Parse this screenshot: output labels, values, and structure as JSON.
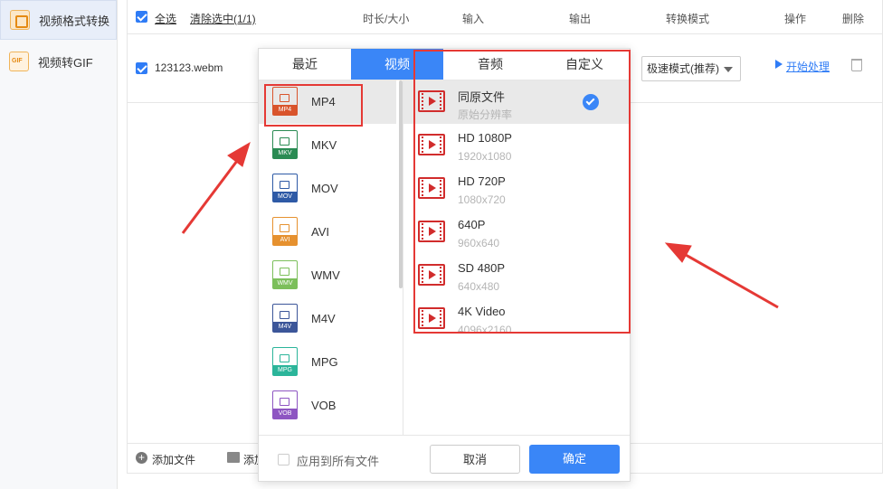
{
  "sidebar": {
    "items": [
      {
        "label": "视频格式转换",
        "active": true,
        "icon": "convert-icon"
      },
      {
        "label": "视频转GIF",
        "active": false,
        "icon": "gif-icon"
      }
    ]
  },
  "header": {
    "select_all": "全选",
    "clear_selected": "清除选中(1/1)",
    "col_duration": "时长/大小",
    "col_input": "输入",
    "col_output": "输出",
    "col_mode": "转换模式",
    "col_action": "操作",
    "col_delete": "删除"
  },
  "file": {
    "name": "123123.webm",
    "mode": "极速模式(推荐)",
    "start": "开始处理"
  },
  "bottom": {
    "add_file": "添加文件",
    "add_folder": "添加"
  },
  "dialog": {
    "tabs": [
      "最近",
      "视频",
      "音频",
      "自定义"
    ],
    "active_tab": "视频",
    "formats": [
      {
        "name": "MP4",
        "label": "MP4",
        "color": "#d9542c"
      },
      {
        "name": "MKV",
        "label": "MKV",
        "color": "#2a8b53"
      },
      {
        "name": "MOV",
        "label": "MOV",
        "color": "#2e5aa6"
      },
      {
        "name": "AVI",
        "label": "AVI",
        "color": "#e6912f"
      },
      {
        "name": "WMV",
        "label": "WMV",
        "color": "#7cbf5b"
      },
      {
        "name": "M4V",
        "label": "M4V",
        "color": "#3c5699"
      },
      {
        "name": "MPG",
        "label": "MPG",
        "color": "#2bb59a"
      },
      {
        "name": "VOB",
        "label": "VOB",
        "color": "#8e56c2"
      }
    ],
    "presets": [
      {
        "name": "同原文件",
        "res": "原始分辨率"
      },
      {
        "name": "HD 1080P",
        "res": "1920x1080"
      },
      {
        "name": "HD 720P",
        "res": "1080x720"
      },
      {
        "name": "640P",
        "res": "960x640"
      },
      {
        "name": "SD 480P",
        "res": "640x480"
      },
      {
        "name": "4K Video",
        "res": "4096x2160"
      }
    ],
    "apply_all": "应用到所有文件",
    "cancel": "取消",
    "confirm": "确定"
  },
  "colors": {
    "accent": "#3a86f7",
    "highlight": "#e53935"
  }
}
